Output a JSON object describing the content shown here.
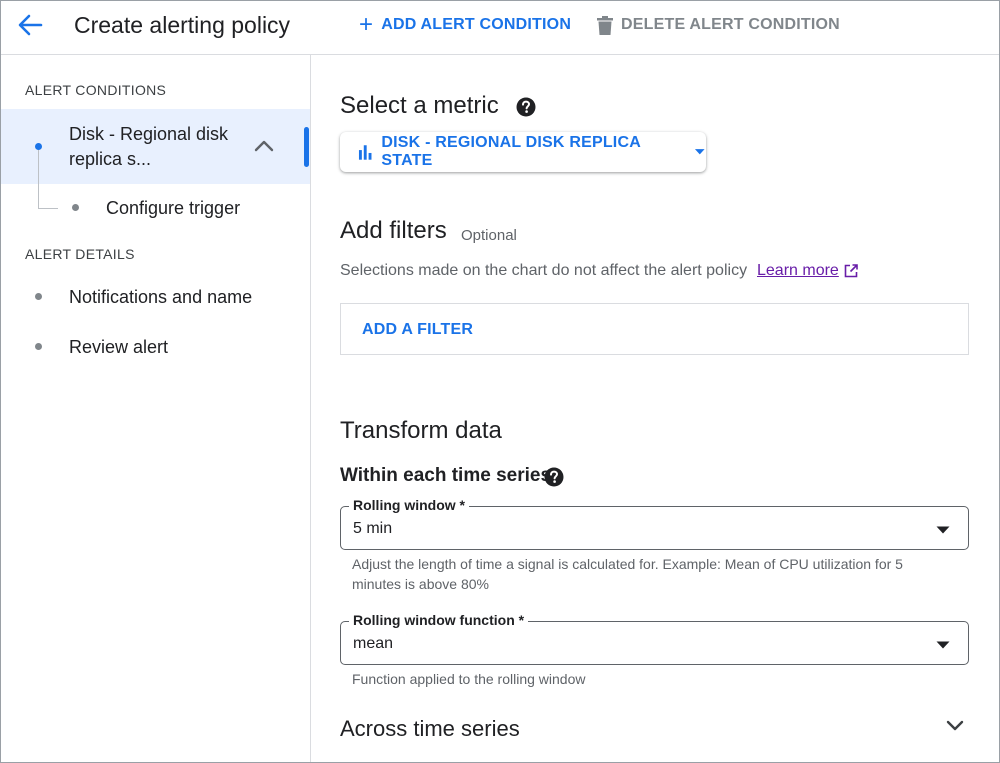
{
  "header": {
    "title": "Create alerting policy",
    "add_condition": "ADD ALERT CONDITION",
    "delete_condition": "DELETE ALERT CONDITION"
  },
  "sidebar": {
    "alert_conditions_label": "ALERT CONDITIONS",
    "condition": {
      "line1": "Disk - Regional disk",
      "line2": "replica s..."
    },
    "configure_trigger": "Configure trigger",
    "alert_details_label": "ALERT DETAILS",
    "notifications": "Notifications and name",
    "review": "Review alert"
  },
  "main": {
    "select_metric_title": "Select a metric",
    "metric_button": "DISK - REGIONAL DISK REPLICA STATE",
    "add_filters_title": "Add filters",
    "optional": "Optional",
    "filter_description": "Selections made on the chart do not affect the alert policy",
    "learn_more": "Learn more",
    "add_filter_button": "ADD A FILTER",
    "transform_title": "Transform data",
    "within_title": "Within each time series",
    "rolling_window": {
      "label": "Rolling window *",
      "value": "5 min",
      "hint_line1": "Adjust the length of time a signal is calculated for. Example: Mean of CPU utilization for 5",
      "hint_line2": "minutes is above 80%"
    },
    "rolling_function": {
      "label": "Rolling window function *",
      "value": "mean",
      "hint": "Function applied to the rolling window"
    },
    "across_title": "Across time series"
  },
  "colors": {
    "accent": "#1a73e8",
    "active_bg": "#e8f0fe",
    "link_visited": "#681da8",
    "muted": "#5f6368"
  },
  "icons": {
    "back": "arrow-left-icon",
    "add": "plus-icon",
    "delete": "trash-icon",
    "help": "help-circle-icon",
    "metric": "bar-chart-icon",
    "external": "external-link-icon",
    "expand": "chevron-down-icon",
    "collapse": "chevron-up-icon"
  }
}
